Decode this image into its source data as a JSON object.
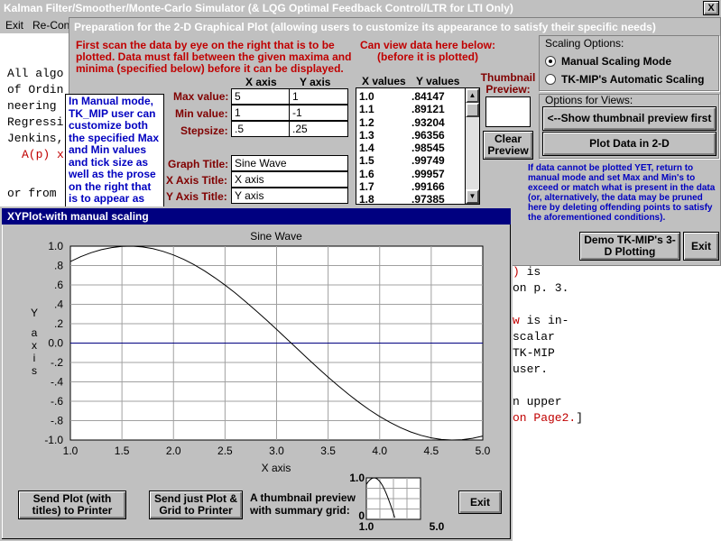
{
  "main_window": {
    "title": "Kalman Filter/Smoother/Monte-Carlo Simulator (& LQG Optimal Feedback Control/LTR for LTI Only)",
    "menu": [
      "Exit",
      "Re-Con"
    ],
    "close_label": "X",
    "bg_text_left": [
      "All algo",
      "of Ordin",
      "neering",
      "Regressi",
      "Jenkins,"
    ],
    "bg_text_left_red": "A(p) x",
    "bg_text_left_bottom": "or from",
    "bg_text_right": [
      {
        "red": ") ",
        "black": "is"
      },
      {
        "red": "",
        "black": "on p. 3."
      },
      {
        "red": "",
        "black": ""
      },
      {
        "red": "w ",
        "black": "is in-"
      },
      {
        "red": "",
        "black": "scalar"
      },
      {
        "red": "",
        "black": "TK-MIP"
      },
      {
        "red": "",
        "black": "user."
      },
      {
        "red": "",
        "black": ""
      },
      {
        "red": "",
        "black": "n upper"
      },
      {
        "red": "on Page2.",
        "black": "]"
      }
    ]
  },
  "prep_dialog": {
    "title": "Preparation for the 2-D Graphical Plot  (allowing users to customize its appearance to satisfy their specific needs)",
    "instructions": "First scan the data by eye on the right that is to be plotted. Data must fall between the given maxima and minima (specified below) before it can be displayed.",
    "view_note": "Can view data here below: (before it is  plotted)",
    "manual_note": "In Manual mode, TK_MIP user can customize both the specified Max and Min values and tick size as well as the  prose on the right that is to appear as the",
    "x_axis_header": "X axis",
    "y_axis_header": "Y axis",
    "max_label": "Max value:",
    "min_label": "Min value:",
    "step_label": "Stepsize:",
    "x_max": "5",
    "y_max": "1",
    "x_min": "1",
    "y_min": "-1",
    "x_step": ".5",
    "y_step": ".25",
    "graph_title_label": "Graph Title:",
    "x_axis_title_label": "X Axis Title:",
    "y_axis_title_label": "Y Axis Title:",
    "graph_title_value": "Sine Wave",
    "x_axis_title_value": "X axis",
    "y_axis_title_value": "Y axis",
    "data_header_x": "X values",
    "data_header_y": "Y values",
    "data_rows": [
      [
        "1.0",
        ".84147"
      ],
      [
        "1.1",
        ".89121"
      ],
      [
        "1.2",
        ".93204"
      ],
      [
        "1.3",
        ".96356"
      ],
      [
        "1.4",
        ".98545"
      ],
      [
        "1.5",
        ".99749"
      ],
      [
        "1.6",
        ".99957"
      ],
      [
        "1.7",
        ".99166"
      ],
      [
        "1.8",
        ".97385"
      ]
    ],
    "thumbnail_label": "Thumbnail Preview:",
    "clear_preview": "Clear Preview",
    "scaling_options_label": "Scaling Options:",
    "manual_scaling": "Manual Scaling Mode",
    "auto_scaling": "TK-MIP's Automatic Scaling",
    "view_options_label": "Options for Views:",
    "show_thumbnail_btn": "<--Show thumbnail preview first",
    "plot_2d_btn": "Plot Data in 2-D",
    "warning_note": "If data cannot be plotted YET, return to manual mode and set Max and Min's to exceed or match what is present in the data (or, alternatively, the data may be pruned here by deleting offending points to satisfy the aforementioned conditions).",
    "demo_3d_btn": "Demo TK-MIP's 3-D Plotting",
    "exit_btn": "Exit"
  },
  "plot_window": {
    "title": "XYPlot-with manual scaling",
    "send_plot_btn": "Send Plot (with titles) to Printer",
    "send_grid_btn": "Send just Plot & Grid to Printer",
    "thumbnail_caption": "A thumbnail preview with summary grid:",
    "exit_btn": "Exit",
    "thumb_ticks": {
      "y_top": "1.0",
      "y_bottom": "0",
      "x_left": "1.0",
      "x_right": "5.0"
    }
  },
  "chart_data": {
    "type": "line",
    "title": "Sine Wave",
    "xlabel": "X axis",
    "ylabel": "Y axis",
    "xlim": [
      1.0,
      5.0
    ],
    "ylim": [
      -1.0,
      1.0
    ],
    "x_ticks": [
      "1.0",
      "1.5",
      "2.0",
      "2.5",
      "3.0",
      "3.5",
      "4.0",
      "4.5",
      "5.0"
    ],
    "y_ticks": [
      "1.0",
      ".8",
      ".6",
      ".4",
      ".2",
      "0.0",
      "-.2",
      "-.4",
      "-.6",
      "-.8",
      "-1.0"
    ],
    "grid": true,
    "series": [
      {
        "x": [
          1.0,
          1.1,
          1.2,
          1.3,
          1.4,
          1.5,
          1.6,
          1.7,
          1.8,
          1.9,
          2.0,
          2.1,
          2.2,
          2.3,
          2.4,
          2.5,
          2.6,
          2.7,
          2.8,
          2.9,
          3.0,
          3.1,
          3.2,
          3.3,
          3.4,
          3.5,
          3.6,
          3.7,
          3.8,
          3.9,
          4.0,
          4.1,
          4.2,
          4.3,
          4.4,
          4.5,
          4.6,
          4.7,
          4.8,
          4.9,
          5.0
        ],
        "y": [
          0.841,
          0.891,
          0.932,
          0.964,
          0.985,
          0.997,
          1.0,
          0.992,
          0.974,
          0.946,
          0.909,
          0.863,
          0.808,
          0.746,
          0.675,
          0.598,
          0.516,
          0.427,
          0.335,
          0.239,
          0.141,
          0.042,
          -0.058,
          -0.158,
          -0.256,
          -0.351,
          -0.443,
          -0.53,
          -0.612,
          -0.688,
          -0.757,
          -0.818,
          -0.872,
          -0.916,
          -0.952,
          -0.978,
          -0.994,
          -1.0,
          -0.996,
          -0.982,
          -0.959
        ]
      }
    ],
    "colors": {
      "line": "#000000",
      "zero_line": "#000080",
      "grid": "#a0a0a0"
    }
  }
}
